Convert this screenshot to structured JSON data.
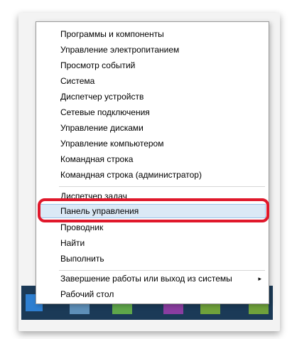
{
  "menu": {
    "items": [
      {
        "label": "Программы и компоненты"
      },
      {
        "label": "Управление электропитанием"
      },
      {
        "label": "Просмотр событий"
      },
      {
        "label": "Система"
      },
      {
        "label": "Диспетчер устройств"
      },
      {
        "label": "Сетевые подключения"
      },
      {
        "label": "Управление дисками"
      },
      {
        "label": "Управление компьютером"
      },
      {
        "label": "Командная строка"
      },
      {
        "label": "Командная строка (администратор)"
      },
      {
        "label": "Диспетчер задач"
      },
      {
        "label": "Панель управления"
      },
      {
        "label": "Проводник"
      },
      {
        "label": "Найти"
      },
      {
        "label": "Выполнить"
      },
      {
        "label": "Завершение работы или выход из системы"
      },
      {
        "label": "Рабочий стол"
      }
    ],
    "submenu_arrow": "▸"
  },
  "colors": {
    "highlight_bg": "#dbe9f6",
    "highlight_border": "#9cc5ea",
    "annotation_red": "#e0182b",
    "taskbar": "#1b3a57"
  }
}
